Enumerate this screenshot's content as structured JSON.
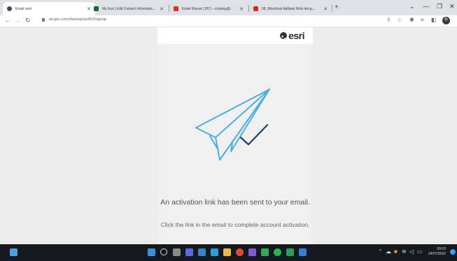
{
  "browser": {
    "tabs": [
      {
        "label": "Email sent",
        "favicon_color": "#4a4a4a",
        "active": true
      },
      {
        "label": "My Esri | Edit Contact Informatio...",
        "favicon_color": "#1d6b3a",
        "active": false
      },
      {
        "label": "Kotak Masuk (187) - ocitaleg@...",
        "favicon_color": "#d93025",
        "active": false
      },
      {
        "label": "08_Membuat Aplikasi Web deng...",
        "favicon_color": "#e62117",
        "active": false
      }
    ],
    "url": "arcgis.com/sharing/oauth2/signup"
  },
  "card": {
    "logo": "esri",
    "message": "An activation link has been sent to your email.",
    "instruction": "Click the link in the email to complete account activation."
  },
  "profile_initial": "R",
  "taskbar": {
    "time": "09:03",
    "date": "24/07/2022"
  },
  "colors": {
    "plane_stroke": "#4aaee3",
    "check_stroke": "#1d3f6b",
    "accent": "#3aa0e8"
  }
}
